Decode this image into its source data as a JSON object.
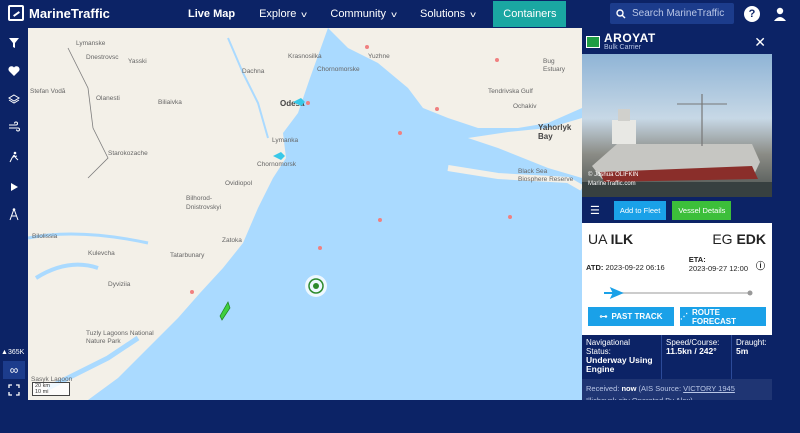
{
  "topbar": {
    "brand": "MarineTraffic",
    "nav": [
      "Live Map",
      "Explore",
      "Community",
      "Solutions"
    ],
    "cta": "Containers",
    "search_placeholder": "Search MarineTraffic",
    "help_icon": "?"
  },
  "sidebar": {
    "icons": [
      "filter-icon",
      "heart-icon",
      "layers-icon",
      "wind-icon",
      "measure-icon",
      "play-icon",
      "location-icon"
    ],
    "count": "365K",
    "bottom_icons": [
      "infinity-icon",
      "expand-icon"
    ]
  },
  "map": {
    "labels": [
      "Lymanske",
      "Dnestrovsc",
      "Stefan Vodă",
      "Olanesti",
      "Biliaivka",
      "Starokozache",
      "Yasski",
      "Dachna",
      "Krasnosilka",
      "Chornomorske",
      "Yuzhne",
      "Odesa",
      "Lymanka",
      "Chornomorsk",
      "Ovidiopol",
      "Bilhorod-Dnistrovskyi",
      "Zatoka",
      "Tatarbunary",
      "Bilolissia",
      "Kulevcha",
      "Dyviziia",
      "Tuzly Lagoons National Nature Park",
      "Sasyk Lagoon",
      "Tendrivska Gulf",
      "Yahorlyk Bay",
      "Black Sea Biosphere Reserve",
      "Ochakiv",
      "Bug Estuary"
    ],
    "scale": [
      "20 km",
      "10 mi"
    ]
  },
  "vessel": {
    "name": "AROYAT",
    "type": "Bulk Carrier",
    "flag_color": "#1f9d44",
    "photo_credit": "© Joshua OLIFKIN",
    "photo_site": "MarineTraffic.com",
    "btn_add": "Add to Fleet",
    "btn_details": "Vessel Details",
    "from_country": "UA",
    "from_port": "ILK",
    "to_country": "EG",
    "to_port": "EDK",
    "atd_label": "ATD:",
    "atd": "2023-09-22 06:16",
    "eta_label": "ETA:",
    "eta": "2023-09-27 12:00",
    "progress": 0.06,
    "past_track": "PAST TRACK",
    "route_forecast": "ROUTE FORECAST",
    "nav_status_label": "Navigational Status:",
    "nav_status": "Underway Using Engine",
    "speed_label": "Speed/Course:",
    "speed": "11.5kn / 242°",
    "draught_label": "Draught:",
    "draught": "5m",
    "received_label": "Received:",
    "received_value": "now",
    "ais_source_pre": "(AIS Source:",
    "ais_source_name": "VICTORY 1945",
    "ais_source_city": "Illichevsk city",
    "ais_source_post": "Operated By Alex)"
  },
  "colors": {
    "navy": "#0c2366",
    "accent": "#1aa1e8",
    "green": "#3cbf3a",
    "teal": "#1aa7a2"
  }
}
